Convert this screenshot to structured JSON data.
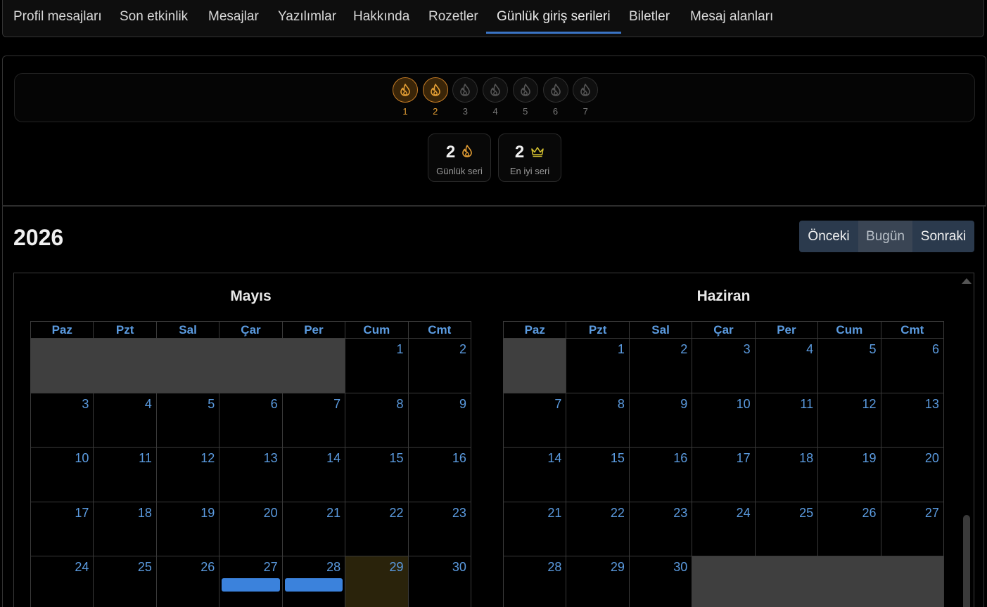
{
  "tabs": [
    {
      "label": "Profil mesajları",
      "active": false
    },
    {
      "label": "Son etkinlik",
      "active": false
    },
    {
      "label": "Mesajlar",
      "active": false
    },
    {
      "label": "Yazılımlar",
      "active": false
    },
    {
      "label": "Hakkında",
      "active": false
    },
    {
      "label": "Rozetler",
      "active": false
    },
    {
      "label": "Günlük giriş serileri",
      "active": true
    },
    {
      "label": "Biletler",
      "active": false
    },
    {
      "label": "Mesaj alanları",
      "active": false
    }
  ],
  "streak": {
    "days": [
      {
        "num": "1",
        "done": true
      },
      {
        "num": "2",
        "done": true
      },
      {
        "num": "3",
        "done": false
      },
      {
        "num": "4",
        "done": false
      },
      {
        "num": "5",
        "done": false
      },
      {
        "num": "6",
        "done": false
      },
      {
        "num": "7",
        "done": false
      }
    ],
    "current": {
      "value": "2",
      "label": "Günlük seri",
      "icon": "flame-icon"
    },
    "best": {
      "value": "2",
      "label": "En iyi seri",
      "icon": "crown-icon"
    },
    "colors": {
      "done": "#e6a035",
      "pending": "#555555",
      "crown": "#d9c531"
    }
  },
  "calendar": {
    "year": "2026",
    "buttons": {
      "prev": "Önceki",
      "today": "Bugün",
      "next": "Sonraki"
    },
    "weekdays": [
      "Paz",
      "Pzt",
      "Sal",
      "Çar",
      "Per",
      "Cum",
      "Cmt"
    ],
    "months": [
      {
        "name": "Mayıs",
        "weeks": [
          [
            "",
            "",
            "",
            "",
            "",
            "1",
            "2"
          ],
          [
            "3",
            "4",
            "5",
            "6",
            "7",
            "8",
            "9"
          ],
          [
            "10",
            "11",
            "12",
            "13",
            "14",
            "15",
            "16"
          ],
          [
            "17",
            "18",
            "19",
            "20",
            "21",
            "22",
            "23"
          ],
          [
            "24",
            "25",
            "26",
            "27",
            "28",
            "29",
            "30"
          ]
        ],
        "today": "29",
        "events": [
          "27",
          "28"
        ]
      },
      {
        "name": "Haziran",
        "weeks": [
          [
            "",
            "1",
            "2",
            "3",
            "4",
            "5",
            "6"
          ],
          [
            "7",
            "8",
            "9",
            "10",
            "11",
            "12",
            "13"
          ],
          [
            "14",
            "15",
            "16",
            "17",
            "18",
            "19",
            "20"
          ],
          [
            "21",
            "22",
            "23",
            "24",
            "25",
            "26",
            "27"
          ],
          [
            "28",
            "29",
            "30",
            "",
            "",
            "",
            ""
          ]
        ],
        "today": "",
        "events": []
      }
    ],
    "colors": {
      "accent": "#5b9be0",
      "event": "#3b82dc",
      "today": "#2a230b",
      "empty": "#3f3f3f"
    }
  }
}
